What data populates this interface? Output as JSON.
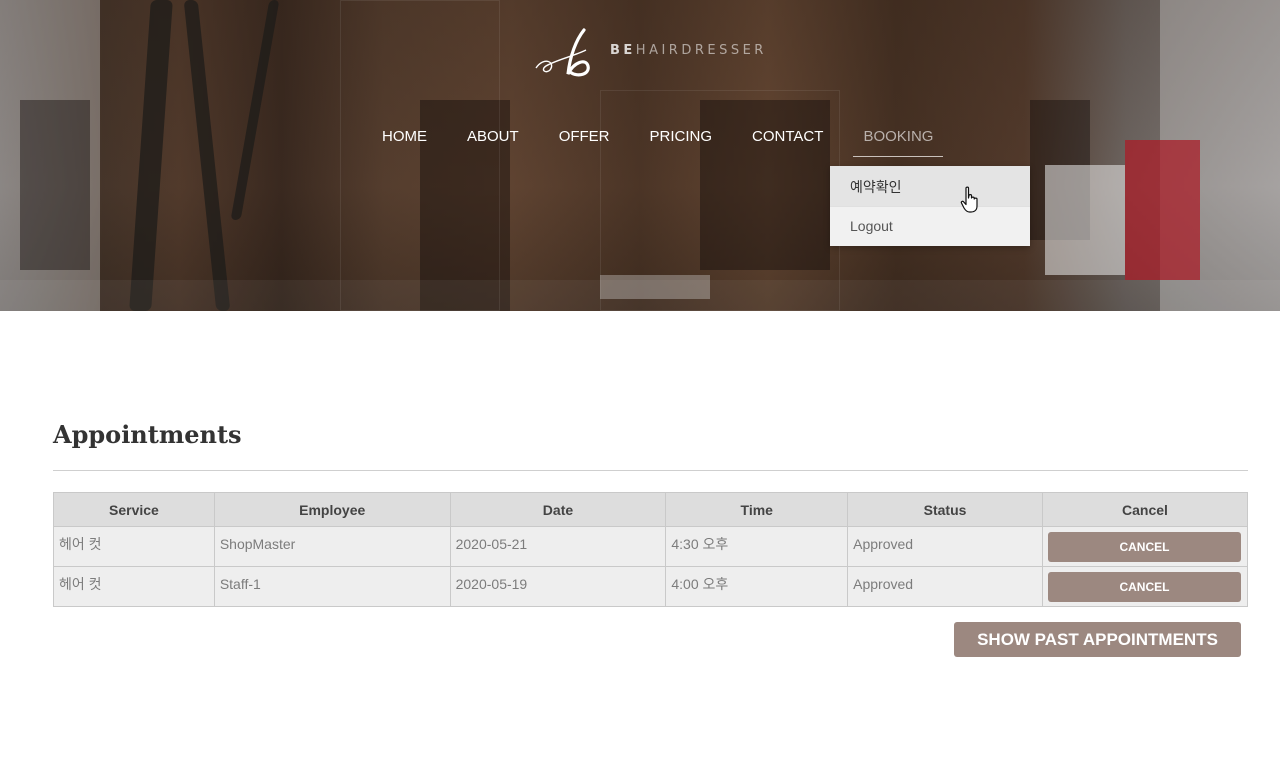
{
  "brand": {
    "bold": "BE",
    "rest": "HAIRDRESSER"
  },
  "nav": {
    "items": [
      "HOME",
      "ABOUT",
      "OFFER",
      "PRICING",
      "CONTACT",
      "BOOKING"
    ],
    "active": "BOOKING"
  },
  "dropdown": {
    "items": [
      "예약확인",
      "Logout"
    ]
  },
  "page": {
    "title": "Appointments"
  },
  "table": {
    "headers": [
      "Service",
      "Employee",
      "Date",
      "Time",
      "Status",
      "Cancel"
    ],
    "rows": [
      {
        "service": "헤어 컷",
        "employee": "ShopMaster",
        "date": "2020-05-21",
        "time": "4:30 오후",
        "status": "Approved",
        "cancel": "CANCEL"
      },
      {
        "service": "헤어 컷",
        "employee": "Staff-1",
        "date": "2020-05-19",
        "time": "4:00 오후",
        "status": "Approved",
        "cancel": "CANCEL"
      }
    ]
  },
  "buttons": {
    "show_past": "SHOW PAST APPOINTMENTS"
  },
  "colors": {
    "accent": "#9c8880",
    "header_bg": "#dddddd",
    "row_bg": "#eeeeee"
  },
  "icons": {
    "cursor": "hand-pointer-icon",
    "logo": "script-b-logo-icon"
  }
}
